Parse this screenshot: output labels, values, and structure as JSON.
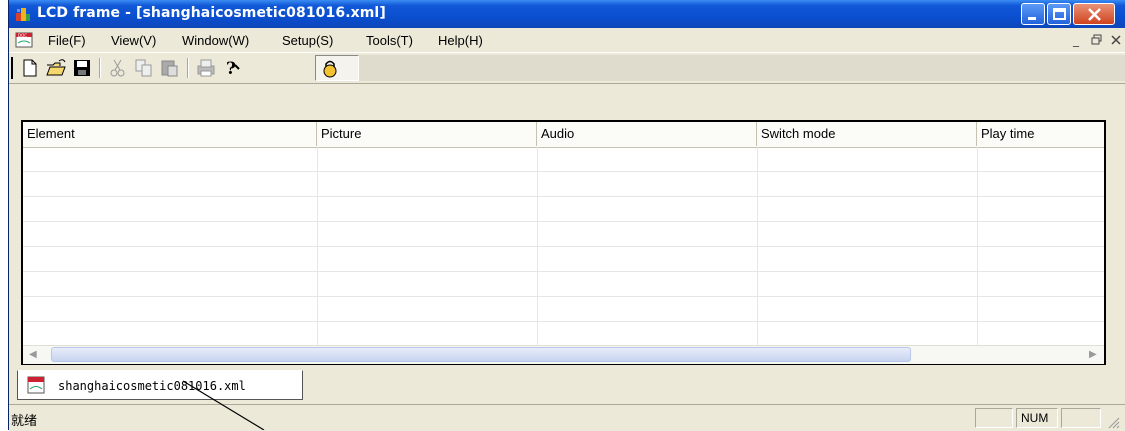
{
  "window": {
    "title": "LCD frame - [shanghaicosmetic081016.xml]",
    "icon": "lcd-frame-app-icon",
    "controls": [
      "minimize-icon",
      "restore-icon",
      "close-icon"
    ]
  },
  "menu": {
    "items": [
      {
        "label": "File(F)"
      },
      {
        "label": "View(V)"
      },
      {
        "label": "Window(W)"
      },
      {
        "label": "Setup(S)"
      },
      {
        "label": "Tools(T)"
      },
      {
        "label": "Help(H)"
      }
    ],
    "mdi_controls": [
      "_",
      "̅",
      "×"
    ]
  },
  "toolbar": {
    "buttons": [
      "new-icon",
      "open-icon",
      "save-icon",
      "cut-icon",
      "copy-icon",
      "paste-icon",
      "print-icon",
      "help-icon",
      "lock-icon"
    ]
  },
  "table": {
    "columns": [
      "Element",
      "Picture",
      "Audio",
      "Switch mode",
      "Play time"
    ],
    "rows": []
  },
  "tab": {
    "label": "shanghaicosmetic081016.xml"
  },
  "status": {
    "text": "就绪",
    "num": "NUM"
  }
}
